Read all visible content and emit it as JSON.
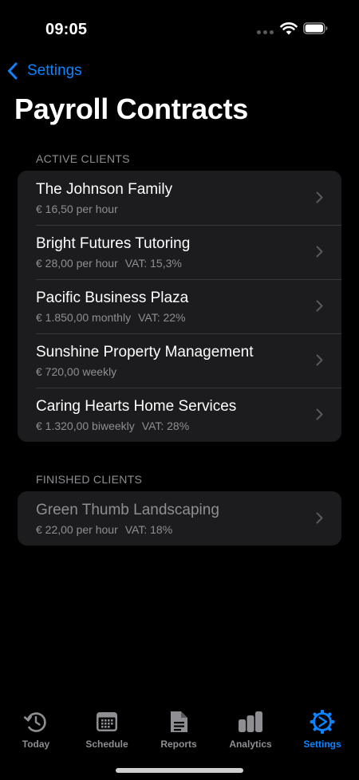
{
  "status_bar": {
    "time": "09:05"
  },
  "nav": {
    "back_label": "Settings",
    "title": "Payroll Contracts"
  },
  "sections": {
    "active": {
      "header": "ACTIVE CLIENTS",
      "items": [
        {
          "name": "The Johnson Family",
          "rate": "€ 16,50 per hour",
          "vat": ""
        },
        {
          "name": "Bright Futures Tutoring",
          "rate": "€ 28,00 per hour",
          "vat": "VAT: 15,3%"
        },
        {
          "name": "Pacific Business Plaza",
          "rate": "€ 1.850,00 monthly",
          "vat": "VAT: 22%"
        },
        {
          "name": "Sunshine Property Management",
          "rate": "€ 720,00 weekly",
          "vat": ""
        },
        {
          "name": "Caring Hearts Home Services",
          "rate": "€ 1.320,00 biweekly",
          "vat": "VAT: 28%"
        }
      ]
    },
    "finished": {
      "header": "FINISHED CLIENTS",
      "items": [
        {
          "name": "Green Thumb Landscaping",
          "rate": "€ 22,00 per hour",
          "vat": "VAT: 18%"
        }
      ]
    }
  },
  "tab_bar": {
    "active_color": "#0a84ff",
    "inactive_color": "#8e8e93",
    "tabs": [
      {
        "label": "Today",
        "icon": "clock-history-icon",
        "active": false
      },
      {
        "label": "Schedule",
        "icon": "calendar-icon",
        "active": false
      },
      {
        "label": "Reports",
        "icon": "document-icon",
        "active": false
      },
      {
        "label": "Analytics",
        "icon": "bar-chart-icon",
        "active": false
      },
      {
        "label": "Settings",
        "icon": "gear-icon",
        "active": true
      }
    ]
  }
}
